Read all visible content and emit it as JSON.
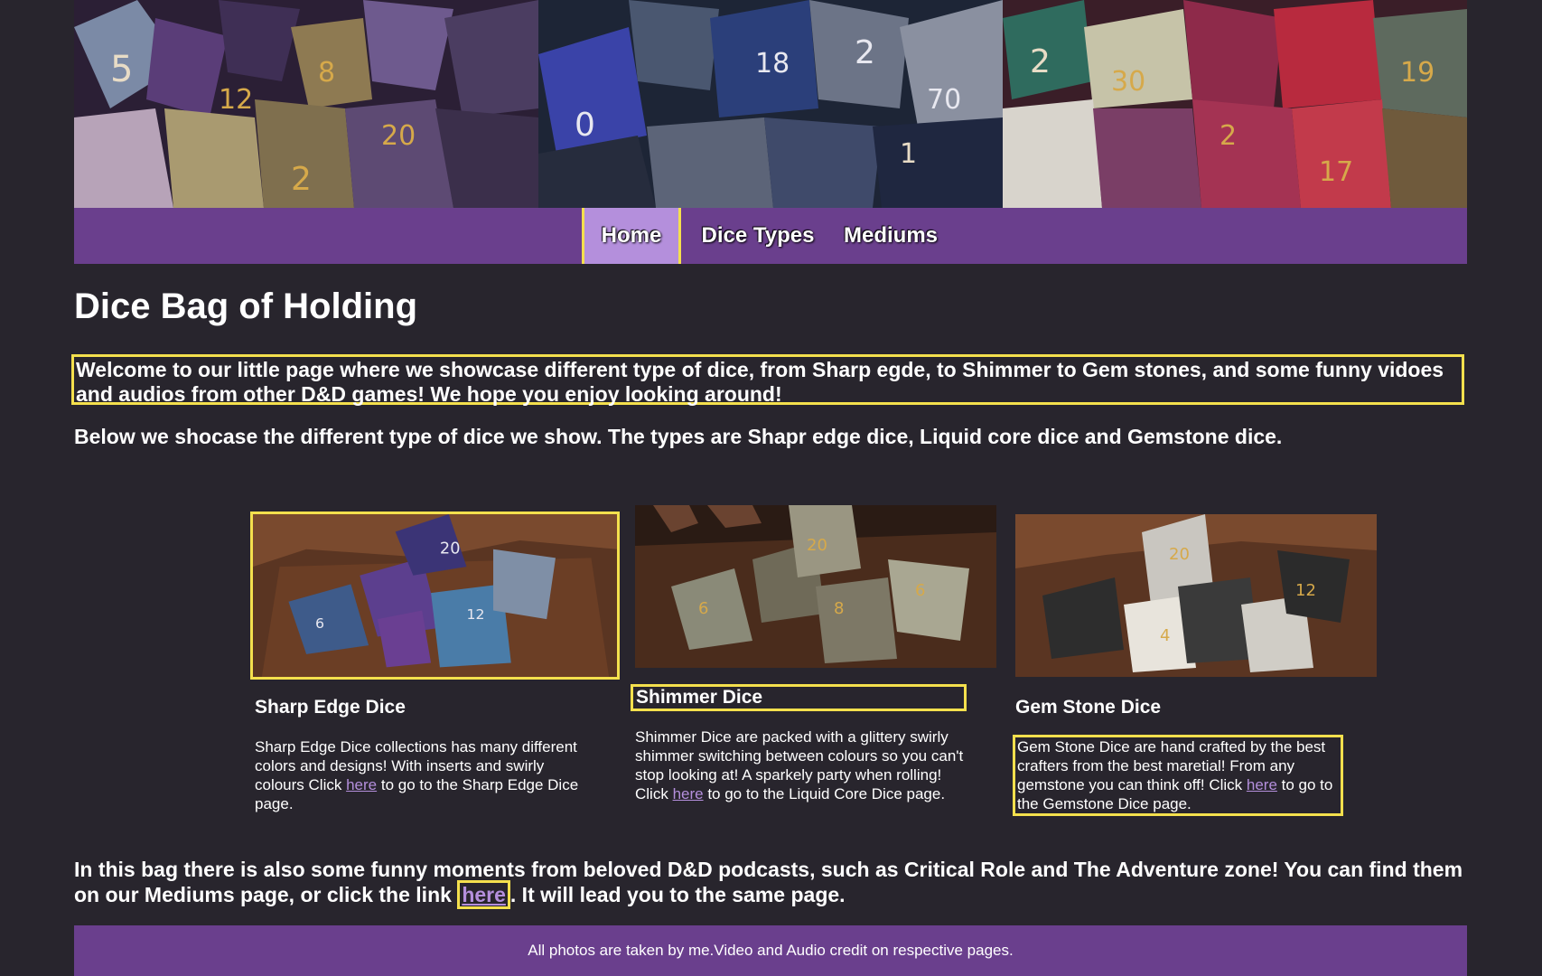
{
  "nav": {
    "items": [
      {
        "label": "Home"
      },
      {
        "label": "Dice Types"
      },
      {
        "label": "Mediums"
      }
    ]
  },
  "main": {
    "title": "Dice Bag of Holding",
    "intro": "Welcome to our little page where we showcase different type of dice, from Sharp egde, to Shimmer to Gem stones, and some funny vidoes and audios from other D&D games! We hope you enjoy looking around!",
    "below": "Below we shocase the different type of dice we show. The types are Shapr edge dice, Liquid core dice and Gemstone dice."
  },
  "cards": [
    {
      "title": "Sharp Edge Dice",
      "text_before": "Sharp Edge Dice collections has many different colors and designs! With inserts and swirly colours Click ",
      "link": "here",
      "text_after": " to go to the Sharp Edge Dice page."
    },
    {
      "title": "Shimmer Dice",
      "text_before": "Shimmer Dice are packed with a glittery swirly shimmer switching between colours so you can't stop looking at! A sparkely party when rolling! Click ",
      "link": "here",
      "text_after": " to go to the Liquid Core Dice page."
    },
    {
      "title": "Gem Stone Dice",
      "text_before": "Gem Stone Dice are hand crafted by the best crafters from the best maretial! From any gemstone you can think off! Click ",
      "link": "here",
      "text_after": " to go to the Gemstone Dice page."
    }
  ],
  "bottom": {
    "text_before": "In this bag there is also some funny moments from beloved D&D podcasts, such as Critical Role and The Adventure zone! You can find them on our Mediums page, or click the link ",
    "link": "here",
    "text_after": ". It will lead you to the same page."
  },
  "footer": {
    "text": "All photos are taken by me.Video and Audio credit on respective pages."
  },
  "colors": {
    "background": "#28252d",
    "nav_purple": "#6a3f8d",
    "nav_active": "#b48fdc",
    "highlight_border": "#f4e04d",
    "link": "#b48fdc"
  }
}
